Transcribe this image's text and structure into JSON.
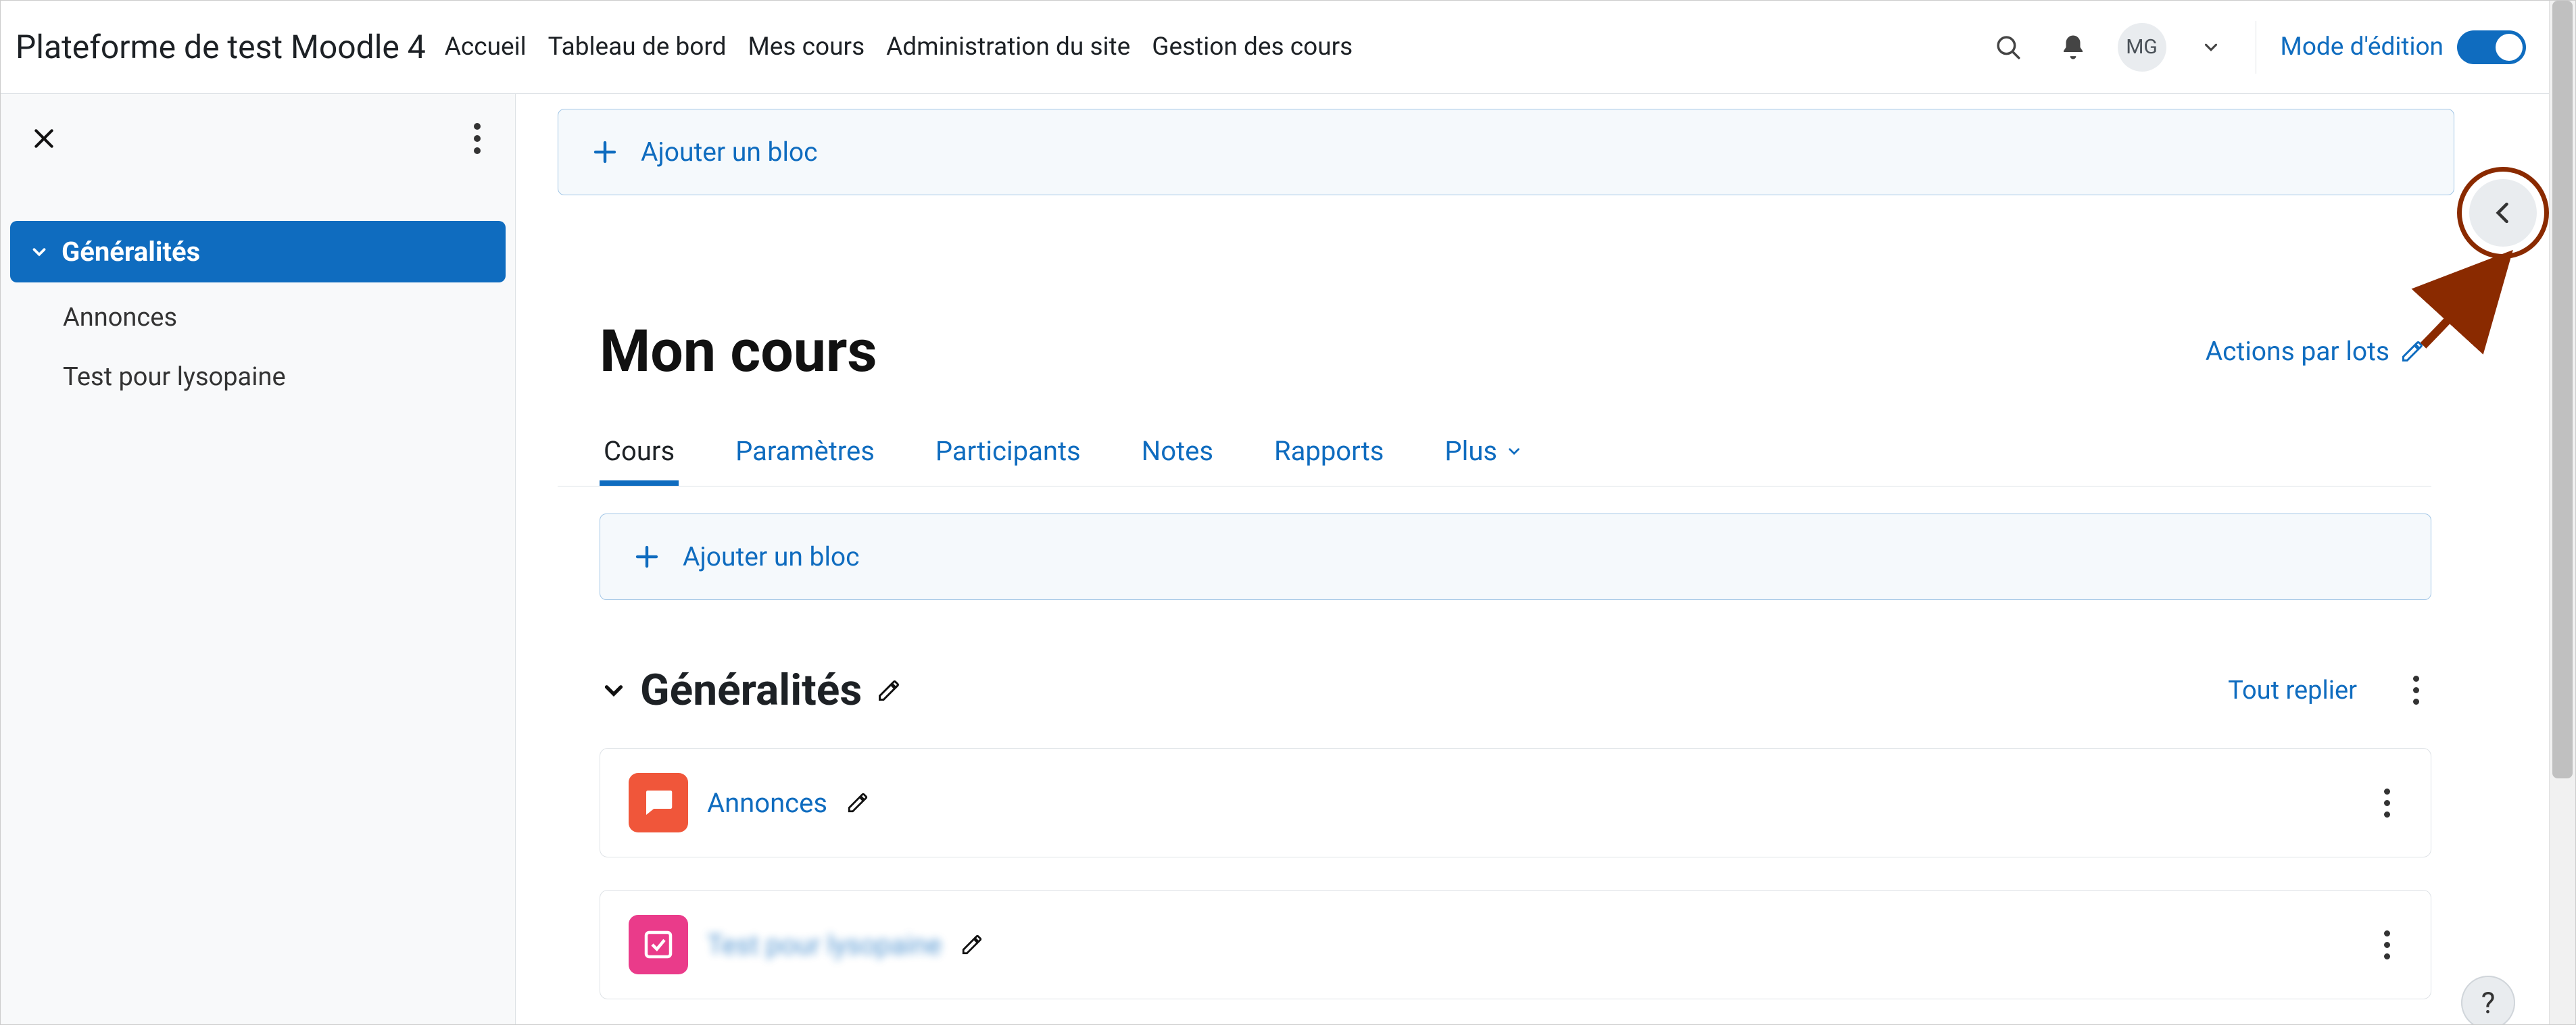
{
  "header": {
    "brand": "Plateforme de test Moodle 4",
    "nav": [
      {
        "label": "Accueil"
      },
      {
        "label": "Tableau de bord"
      },
      {
        "label": "Mes cours"
      },
      {
        "label": "Administration du site"
      },
      {
        "label": "Gestion des cours"
      }
    ],
    "user_initials": "MG",
    "edit_mode_label": "Mode d'édition",
    "edit_mode_on": true,
    "icons": {
      "search": "search-icon",
      "notifications": "bell-icon",
      "dropdown": "chevron-down-icon"
    }
  },
  "sidebar": {
    "items": [
      {
        "label": "Généralités",
        "active": true,
        "expandable": true
      },
      {
        "label": "Annonces"
      },
      {
        "label": "Test pour lysopaine"
      }
    ]
  },
  "main": {
    "add_block_label": "Ajouter un bloc",
    "title": "Mon cours",
    "batch_actions_label": "Actions par lots",
    "tabs": [
      {
        "label": "Cours",
        "active": true
      },
      {
        "label": "Paramètres"
      },
      {
        "label": "Participants"
      },
      {
        "label": "Notes"
      },
      {
        "label": "Rapports"
      },
      {
        "label": "Plus",
        "has_menu": true
      }
    ],
    "section": {
      "title": "Généralités",
      "collapse_all_label": "Tout replier",
      "activities": [
        {
          "name": "Annonces",
          "icon": "forum-icon",
          "color": "orange",
          "blurred": false
        },
        {
          "name": "Test pour lysopaine",
          "icon": "feedback-icon",
          "color": "pink",
          "blurred": true
        }
      ]
    }
  },
  "help_label": "?",
  "colors": {
    "link": "#0f6cbf",
    "highlight": "#8a2a00",
    "activity_orange": "#f0563a",
    "activity_pink": "#ea3b8a"
  }
}
